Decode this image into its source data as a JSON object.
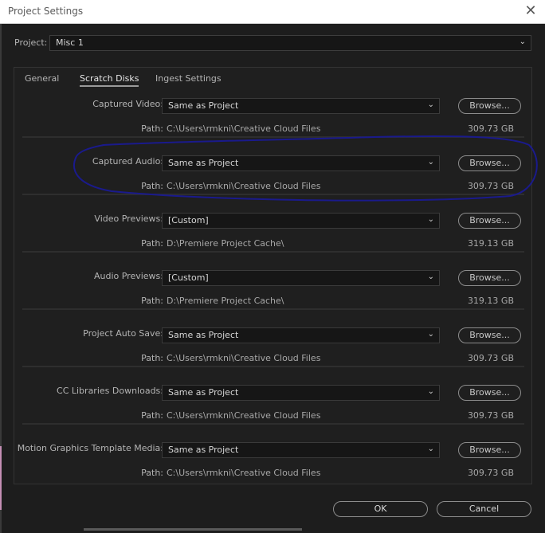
{
  "window": {
    "title": "Project Settings",
    "close_glyph": "✕"
  },
  "project": {
    "label": "Project:",
    "value": "Misc 1",
    "chevron_glyph": "⌄"
  },
  "tabs": [
    {
      "label": "General",
      "active": false
    },
    {
      "label": "Scratch Disks",
      "active": true
    },
    {
      "label": "Ingest Settings",
      "active": false
    }
  ],
  "path_label": "Path:",
  "browse_label": "Browse...",
  "rows": [
    {
      "label": "Captured Video:",
      "value": "Same as Project",
      "path": "C:\\Users\\rmkni\\Creative Cloud Files",
      "size": "309.73 GB"
    },
    {
      "label": "Captured Audio:",
      "value": "Same as Project",
      "path": "C:\\Users\\rmkni\\Creative Cloud Files",
      "size": "309.73 GB"
    },
    {
      "label": "Video Previews:",
      "value": "[Custom]",
      "path": "D:\\Premiere Project Cache\\",
      "size": "319.13 GB"
    },
    {
      "label": "Audio Previews:",
      "value": "[Custom]",
      "path": "D:\\Premiere Project Cache\\",
      "size": "319.13 GB"
    },
    {
      "label": "Project Auto Save:",
      "value": "Same as Project",
      "path": "C:\\Users\\rmkni\\Creative Cloud Files",
      "size": "309.73 GB"
    },
    {
      "label": "CC Libraries Downloads:",
      "value": "Same as Project",
      "path": "C:\\Users\\rmkni\\Creative Cloud Files",
      "size": "309.73 GB"
    },
    {
      "label": "Motion Graphics Template Media:",
      "value": "Same as Project",
      "path": "C:\\Users\\rmkni\\Creative Cloud Files",
      "size": "309.73 GB"
    }
  ],
  "footer": {
    "ok_label": "OK",
    "cancel_label": "Cancel"
  },
  "colors": {
    "annotation": "#1a1a8c",
    "background": "#1d1d1d"
  }
}
